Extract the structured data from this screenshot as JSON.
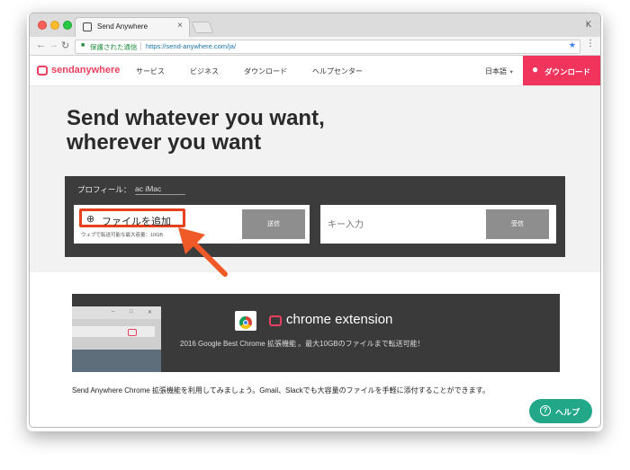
{
  "browser": {
    "tab_title": "Send Anywhere",
    "tab_close": "×",
    "profile_initial": "K",
    "secure_label": "保護された通信",
    "url": "https://send-anywhere.com/ja/"
  },
  "header": {
    "logo_text": "sendanywhere",
    "nav": [
      "サービス",
      "ビジネス",
      "ダウンロード",
      "ヘルプセンター"
    ],
    "language": "日本語",
    "download_label": "ダウンロード"
  },
  "hero": {
    "headline_line1": "Send whatever you want,",
    "headline_line2": "wherever you want",
    "profile_label": "プロフィール：",
    "profile_name": "ac iMac",
    "add_files_label": "ファイルを追加",
    "limit_text": "ウェブで転送可能な最大容量：10GB",
    "send_label": "送信",
    "key_placeholder": "キー入力",
    "receive_label": "受信"
  },
  "promo": {
    "extension_title": "chrome extension",
    "extension_subtitle": "2016 Google Best Chrome 拡張機能 。最大10GBのファイルまで転送可能！",
    "intro_text": "Send Anywhere Chrome 拡張機能を利用してみましょう。Gmail、Slackでも大容量のファイルを手軽に添付することができます。"
  },
  "help": {
    "label": "ヘルプ"
  },
  "colors": {
    "brand": "#e8405e",
    "download_bg": "#f0345b",
    "help_bg": "#22a889",
    "highlight": "#e8401e"
  }
}
